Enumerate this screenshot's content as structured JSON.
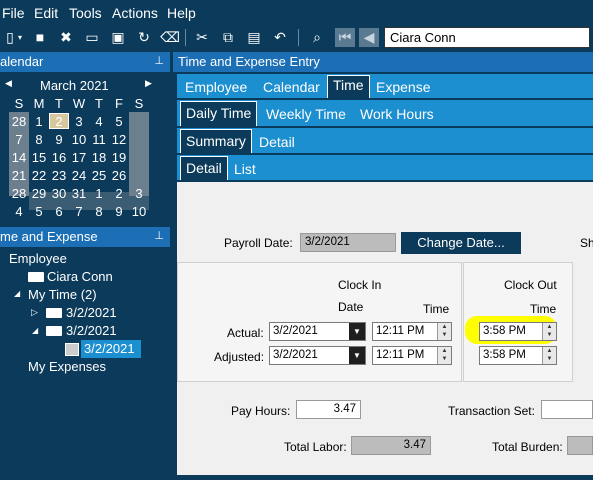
{
  "menu": {
    "file": "File",
    "edit": "Edit",
    "tools": "Tools",
    "actions": "Actions",
    "help": "Help"
  },
  "search": {
    "value": "Ciara Conn"
  },
  "calendar_panel": {
    "title": "alendar",
    "pin": "ꟸ",
    "month": "March 2021",
    "weekdays": [
      "S",
      "M",
      "T",
      "W",
      "T",
      "F",
      "S"
    ],
    "weeks": [
      [
        "28",
        "1",
        "2",
        "3",
        "4",
        "5",
        ""
      ],
      [
        "7",
        "8",
        "9",
        "10",
        "11",
        "12",
        ""
      ],
      [
        "14",
        "15",
        "16",
        "17",
        "18",
        "19",
        ""
      ],
      [
        "21",
        "22",
        "23",
        "24",
        "25",
        "26",
        ""
      ],
      [
        "28",
        "29",
        "30",
        "31",
        "1",
        "2",
        "3"
      ],
      [
        "4",
        "5",
        "6",
        "7",
        "8",
        "9",
        "10"
      ]
    ]
  },
  "tree_panel": {
    "title": "me and Expense",
    "pin": "ꟸ",
    "items": {
      "employee": "Employee",
      "person": "Ciara Conn",
      "mytime": "My Time (2)",
      "week1": "3/2/2021",
      "week2": "3/2/2021",
      "entry": "3/2/2021",
      "expenses": "My Expenses"
    }
  },
  "main": {
    "title": "Time and Expense Entry",
    "tabs1": [
      "Employee",
      "Calendar",
      "Time",
      "Expense"
    ],
    "tabs2": [
      "Daily Time",
      "Weekly Time",
      "Work Hours"
    ],
    "tabs3": [
      "Summary",
      "Detail"
    ],
    "tabs4": [
      "Detail",
      "List"
    ]
  },
  "form": {
    "payroll_label": "Payroll Date:",
    "payroll_value": "3/2/2021",
    "change_date": "Change Date...",
    "cut_label": "Sh",
    "clock_in": "Clock In",
    "date_h": "Date",
    "time_h": "Time",
    "clock_out": "Clock Out",
    "time_h2": "Time",
    "actual_label": "Actual:",
    "actual_date": "3/2/2021",
    "actual_in": "12:11 PM",
    "actual_out": "3:58 PM",
    "adjusted_label": "Adjusted:",
    "adjusted_date": "3/2/2021",
    "adjusted_in": "12:11 PM",
    "adjusted_out": "3:58 PM",
    "pay_hours_label": "Pay Hours:",
    "pay_hours": "3.47",
    "trans_label": "Transaction Set:",
    "total_labor_label": "Total Labor:",
    "total_labor": "3.47",
    "total_burden_label": "Total Burden:"
  },
  "colors": {
    "highlight": "#ffff00",
    "accent": "#1c8fd0",
    "dark": "#0b3a5a"
  }
}
